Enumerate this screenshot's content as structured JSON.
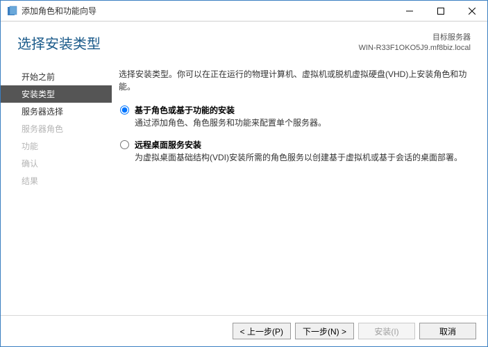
{
  "titlebar": {
    "title": "添加角色和功能向导"
  },
  "header": {
    "page_title": "选择安装类型",
    "target_label": "目标服务器",
    "target_value": "WIN-R33F1OKO5J9.mf8biz.local"
  },
  "sidebar": {
    "items": [
      {
        "label": "开始之前",
        "state": "done"
      },
      {
        "label": "安装类型",
        "state": "active"
      },
      {
        "label": "服务器选择",
        "state": "done"
      },
      {
        "label": "服务器角色",
        "state": "disabled"
      },
      {
        "label": "功能",
        "state": "disabled"
      },
      {
        "label": "确认",
        "state": "disabled"
      },
      {
        "label": "结果",
        "state": "disabled"
      }
    ]
  },
  "content": {
    "instruction": "选择安装类型。你可以在正在运行的物理计算机、虚拟机或脱机虚拟硬盘(VHD)上安装角色和功能。",
    "options": [
      {
        "title": "基于角色或基于功能的安装",
        "desc": "通过添加角色、角色服务和功能来配置单个服务器。",
        "selected": true
      },
      {
        "title": "远程桌面服务安装",
        "desc": "为虚拟桌面基础结构(VDI)安装所需的角色服务以创建基于虚拟机或基于会话的桌面部署。",
        "selected": false
      }
    ]
  },
  "footer": {
    "prev": "< 上一步(P)",
    "next": "下一步(N) >",
    "install": "安装(I)",
    "cancel": "取消"
  }
}
